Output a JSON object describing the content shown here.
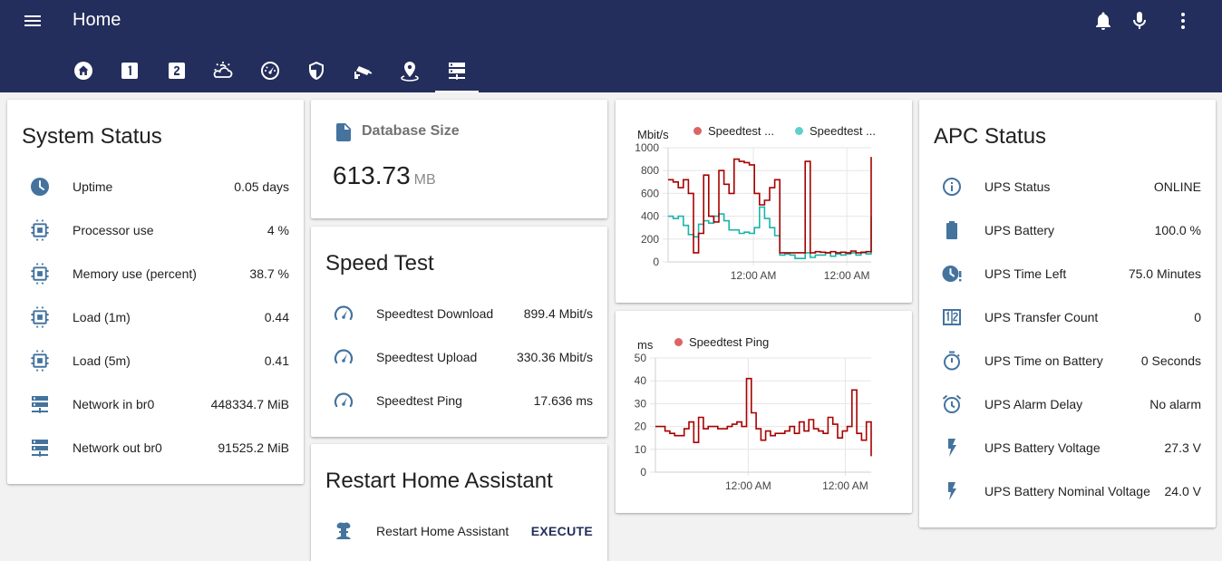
{
  "header": {
    "title": "Home",
    "icons": [
      "menu-icon",
      "bell-icon",
      "microphone-icon",
      "more-vert-icon"
    ],
    "tabs": [
      {
        "name": "tab-home",
        "icon": "home-icon"
      },
      {
        "name": "tab-one",
        "icon": "numeric-1-box-icon"
      },
      {
        "name": "tab-two",
        "icon": "numeric-2-box-icon"
      },
      {
        "name": "tab-weather",
        "icon": "weather-partly-cloudy-icon"
      },
      {
        "name": "tab-speedometer",
        "icon": "speedometer-icon"
      },
      {
        "name": "tab-security",
        "icon": "shield-icon"
      },
      {
        "name": "tab-cctv",
        "icon": "cctv-icon"
      },
      {
        "name": "tab-map",
        "icon": "map-marker-icon"
      },
      {
        "name": "tab-server",
        "icon": "server-network-icon",
        "active": true
      }
    ]
  },
  "system_status": {
    "title": "System Status",
    "rows": [
      {
        "label": "Uptime",
        "value": "0.05 days",
        "icon": "clock-icon"
      },
      {
        "label": "Processor use",
        "value": "4 %",
        "icon": "chip-icon"
      },
      {
        "label": "Memory use (percent)",
        "value": "38.7 %",
        "icon": "chip-icon"
      },
      {
        "label": "Load (1m)",
        "value": "0.44",
        "icon": "chip-icon"
      },
      {
        "label": "Load (5m)",
        "value": "0.41",
        "icon": "chip-icon"
      },
      {
        "label": "Network in br0",
        "value": "448334.7 MiB",
        "icon": "server-network-icon"
      },
      {
        "label": "Network out br0",
        "value": "91525.2 MiB",
        "icon": "server-network-icon"
      }
    ]
  },
  "database": {
    "label": "Database Size",
    "value": "613.73",
    "unit": "MB",
    "icon": "file-icon"
  },
  "speed_test": {
    "title": "Speed Test",
    "rows": [
      {
        "label": "Speedtest Download",
        "value": "899.4 Mbit/s",
        "icon": "speedometer-icon"
      },
      {
        "label": "Speedtest Upload",
        "value": "330.36 Mbit/s",
        "icon": "speedometer-icon"
      },
      {
        "label": "Speedtest Ping",
        "value": "17.636 ms",
        "icon": "speedometer-icon"
      }
    ]
  },
  "restart": {
    "title": "Restart Home Assistant",
    "label": "Restart Home Assistant",
    "action": "EXECUTE",
    "icon": "nuke-icon"
  },
  "apc_status": {
    "title": "APC Status",
    "rows": [
      {
        "label": "UPS Status",
        "value": "ONLINE",
        "icon": "information-outline-icon"
      },
      {
        "label": "UPS Battery",
        "value": "100.0 %",
        "icon": "battery-icon"
      },
      {
        "label": "UPS Time Left",
        "value": "75.0 Minutes",
        "icon": "clock-alert-icon"
      },
      {
        "label": "UPS Transfer Count",
        "value": "0",
        "icon": "counter-icon"
      },
      {
        "label": "UPS Time on Battery",
        "value": "0 Seconds",
        "icon": "timer-icon"
      },
      {
        "label": "UPS Alarm Delay",
        "value": "No alarm",
        "icon": "alarm-icon"
      },
      {
        "label": "UPS Battery Voltage",
        "value": "27.3 V",
        "icon": "flash-icon"
      },
      {
        "label": "UPS Battery Nominal Voltage",
        "value": "24.0 V",
        "icon": "flash-icon"
      }
    ]
  },
  "colors": {
    "header_bg": "#232e5c",
    "icon": "#44739e",
    "accent": "#232e5c",
    "download_line": "#a80000",
    "upload_line": "#1ab5a8",
    "download_dot": "#db6565",
    "upload_dot": "#5fd0cb"
  },
  "chart_data": [
    {
      "type": "line",
      "ylabel": "Mbit/s",
      "ylim": [
        0,
        1000
      ],
      "yticks": [
        "0",
        "200",
        "400",
        "600",
        "800",
        "1000"
      ],
      "xticks": [
        "12:00 AM",
        "12:00 AM"
      ],
      "grid": true,
      "legend": "top",
      "series": [
        {
          "name": "Speedtest ...",
          "color": "#a80000",
          "step": true,
          "values": [
            720,
            700,
            650,
            720,
            600,
            80,
            250,
            760,
            400,
            350,
            800,
            680,
            600,
            900,
            880,
            870,
            850,
            600,
            500,
            540,
            650,
            720,
            80,
            80,
            80,
            80,
            80,
            880,
            80,
            90,
            85,
            80,
            90,
            80,
            85,
            80,
            95,
            80,
            85,
            90,
            920
          ]
        },
        {
          "name": "Speedtest ...",
          "color": "#1ab5a8",
          "step": true,
          "values": [
            400,
            380,
            400,
            320,
            240,
            220,
            330,
            360,
            340,
            400,
            420,
            360,
            280,
            280,
            250,
            260,
            250,
            300,
            480,
            380,
            300,
            230,
            60,
            70,
            60,
            30,
            30,
            80,
            40,
            60,
            60,
            80,
            50,
            70,
            60,
            70,
            80,
            60,
            80,
            70,
            400
          ]
        }
      ]
    },
    {
      "type": "line",
      "ylabel": "ms",
      "ylim": [
        0,
        50
      ],
      "yticks": [
        "0",
        "10",
        "20",
        "30",
        "40",
        "50"
      ],
      "xticks": [
        "12:00 AM",
        "12:00 AM"
      ],
      "grid": true,
      "legend": "top",
      "series": [
        {
          "name": "Speedtest Ping",
          "color": "#a80000",
          "step": true,
          "values": [
            20,
            20,
            18,
            17,
            16,
            16,
            19,
            22,
            13,
            24,
            19,
            20,
            20,
            19,
            19,
            20,
            21,
            22,
            20,
            41,
            26,
            19,
            14,
            18,
            16,
            17,
            17,
            18,
            20,
            17,
            22,
            18,
            23,
            19,
            18,
            17,
            24,
            21,
            15,
            18,
            20,
            36,
            17,
            14,
            22,
            7
          ]
        }
      ]
    }
  ]
}
